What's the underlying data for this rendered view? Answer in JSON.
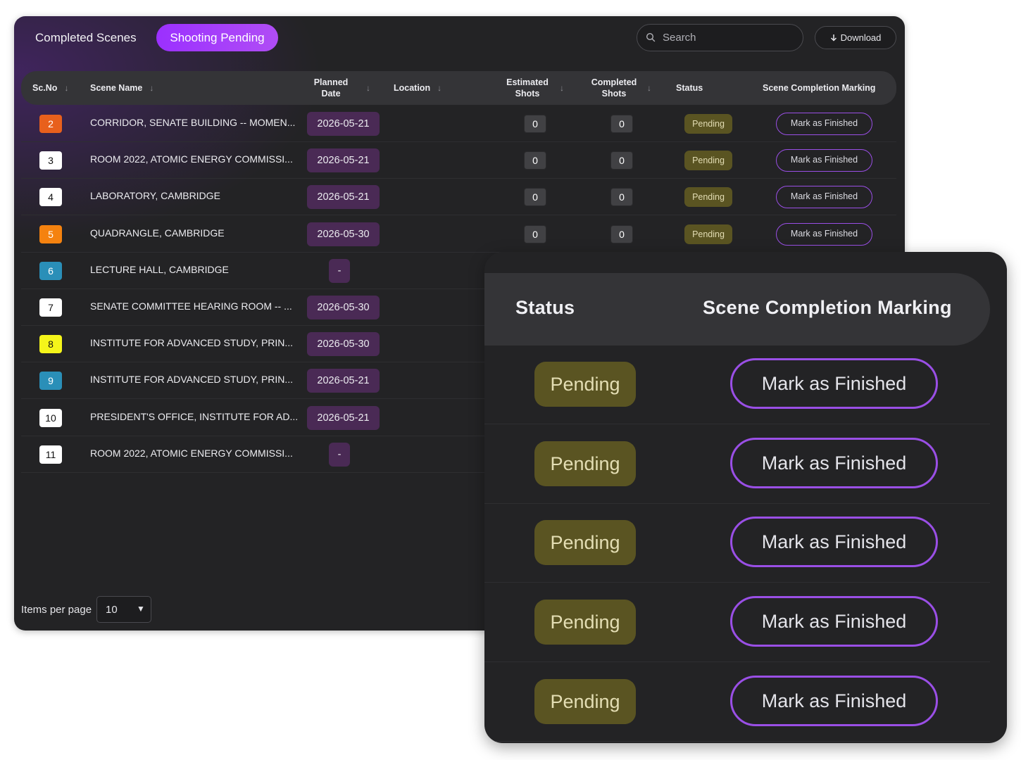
{
  "tabs": {
    "completed": "Completed Scenes",
    "pending": "Shooting Pending"
  },
  "search": {
    "placeholder": "Search"
  },
  "download_label": "Download",
  "columns": {
    "scno": "Sc.No",
    "scene_name": "Scene Name",
    "planned_date": "Planned Date",
    "location": "Location",
    "estimated_shots": "Estimated Shots",
    "completed_shots": "Completed Shots",
    "status": "Status",
    "completion": "Scene Completion Marking"
  },
  "rows": [
    {
      "num": "2",
      "color": "#e8601c",
      "text_color": "#ffffff",
      "name": "CORRIDOR, SENATE BUILDING -- MOMEN...",
      "date": "2026-05-21",
      "est": "0",
      "comp": "0",
      "status": "Pending",
      "action": "Mark as Finished"
    },
    {
      "num": "3",
      "color": "#ffffff",
      "text_color": "#111111",
      "name": "ROOM 2022, ATOMIC ENERGY COMMISSI...",
      "date": "2026-05-21",
      "est": "0",
      "comp": "0",
      "status": "Pending",
      "action": "Mark as Finished"
    },
    {
      "num": "4",
      "color": "#ffffff",
      "text_color": "#111111",
      "name": "LABORATORY, CAMBRIDGE",
      "date": "2026-05-21",
      "est": "0",
      "comp": "0",
      "status": "Pending",
      "action": "Mark as Finished"
    },
    {
      "num": "5",
      "color": "#f5820f",
      "text_color": "#ffffff",
      "name": "QUADRANGLE, CAMBRIDGE",
      "date": "2026-05-30",
      "est": "0",
      "comp": "0",
      "status": "Pending",
      "action": "Mark as Finished"
    },
    {
      "num": "6",
      "color": "#2a8fb8",
      "text_color": "#ffffff",
      "name": "LECTURE HALL, CAMBRIDGE",
      "date": "-"
    },
    {
      "num": "7",
      "color": "#ffffff",
      "text_color": "#111111",
      "name": "SENATE COMMITTEE HEARING ROOM -- ...",
      "date": "2026-05-30"
    },
    {
      "num": "8",
      "color": "#f5f51a",
      "text_color": "#111111",
      "name": "INSTITUTE FOR ADVANCED STUDY, PRIN...",
      "date": "2026-05-30"
    },
    {
      "num": "9",
      "color": "#2a8fb8",
      "text_color": "#ffffff",
      "name": "INSTITUTE FOR ADVANCED STUDY, PRIN...",
      "date": "2026-05-21"
    },
    {
      "num": "10",
      "color": "#ffffff",
      "text_color": "#111111",
      "name": "PRESIDENT'S OFFICE, INSTITUTE FOR AD...",
      "date": "2026-05-21"
    },
    {
      "num": "11",
      "color": "#ffffff",
      "text_color": "#111111",
      "name": "ROOM 2022, ATOMIC ENERGY COMMISSI...",
      "date": "-"
    }
  ],
  "pagination": {
    "label": "Items per page",
    "value": "10"
  },
  "zoom": {
    "status_header": "Status",
    "completion_header": "Scene Completion Marking",
    "rows": [
      {
        "status": "Pending",
        "action": "Mark as Finished"
      },
      {
        "status": "Pending",
        "action": "Mark as Finished"
      },
      {
        "status": "Pending",
        "action": "Mark as Finished"
      },
      {
        "status": "Pending",
        "action": "Mark as Finished"
      },
      {
        "status": "Pending",
        "action": "Mark as Finished"
      }
    ]
  }
}
